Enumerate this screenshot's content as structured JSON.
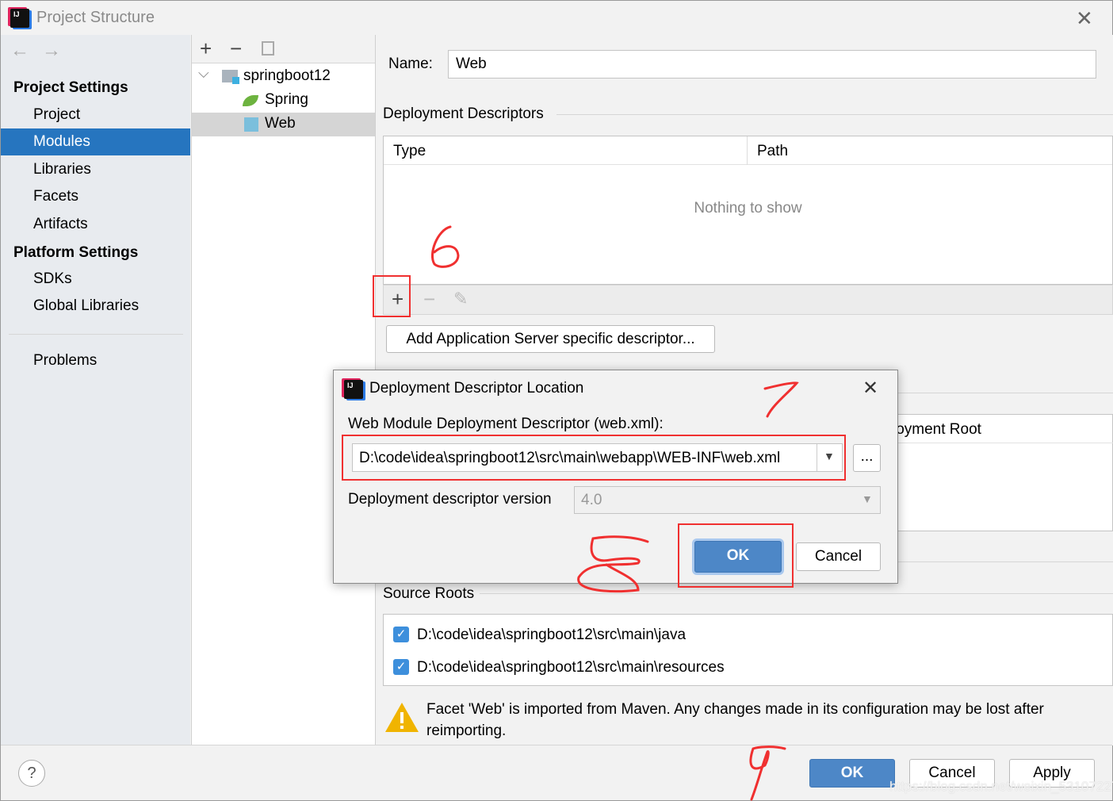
{
  "window": {
    "title": "Project Structure",
    "close_icon": "close-icon"
  },
  "sidebar": {
    "project_settings": "Project Settings",
    "items": [
      {
        "label": "Project"
      },
      {
        "label": "Modules",
        "selected": true
      },
      {
        "label": "Libraries"
      },
      {
        "label": "Facets"
      },
      {
        "label": "Artifacts"
      }
    ],
    "platform_settings": "Platform Settings",
    "platform_items": [
      {
        "label": "SDKs"
      },
      {
        "label": "Global Libraries"
      }
    ],
    "problems": "Problems"
  },
  "tree": {
    "root": "springboot12",
    "children": [
      {
        "label": "Spring",
        "icon": "spring-leaf-icon"
      },
      {
        "label": "Web",
        "icon": "web-facet-icon",
        "selected": true
      }
    ]
  },
  "main": {
    "name_label": "Name:",
    "name_value": "Web",
    "deployment_descriptors": "Deployment Descriptors",
    "columns": [
      "Type",
      "Path"
    ],
    "empty_text": "Nothing to show",
    "add_server_descriptor": "Add Application Server specific descriptor...",
    "web_resource_header_partial": "loyment Root",
    "source_roots": "Source Roots",
    "roots": [
      {
        "path": "D:\\code\\idea\\springboot12\\src\\main\\java",
        "checked": true
      },
      {
        "path": "D:\\code\\idea\\springboot12\\src\\main\\resources",
        "checked": true
      }
    ],
    "warning": "Facet 'Web' is imported from Maven. Any changes made in its configuration may be lost after reimporting."
  },
  "dialog": {
    "title": "Deployment Descriptor Location",
    "descriptor_label": "Web Module Deployment Descriptor (web.xml):",
    "descriptor_value": "D:\\code\\idea\\springboot12\\src\\main\\webapp\\WEB-INF\\web.xml",
    "browse": "...",
    "version_label": "Deployment descriptor version",
    "version_value": "4.0",
    "ok": "OK",
    "cancel": "Cancel"
  },
  "footer": {
    "help": "?",
    "ok": "OK",
    "cancel": "Cancel",
    "apply": "Apply"
  },
  "watermark": "https://blog.csdn.net/weixin_53107227",
  "annotations": [
    "6",
    "7",
    "8",
    "9"
  ],
  "colors": {
    "selection": "#2675bf",
    "primary_button": "#4d87c7",
    "annotation": "#f03030",
    "warning": "#f0b400"
  }
}
